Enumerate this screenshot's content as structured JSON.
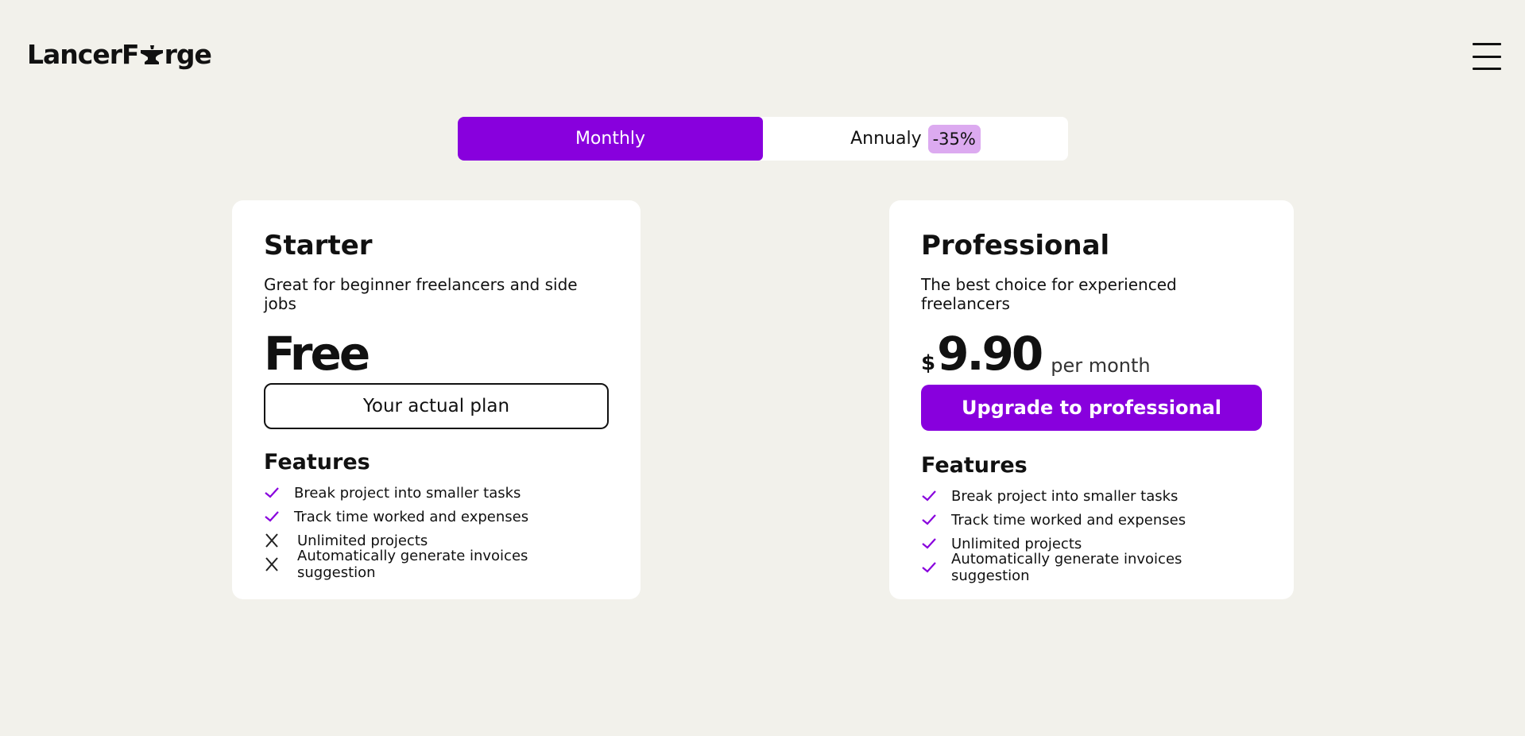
{
  "header": {
    "logo_left": "LancerF",
    "logo_right": "rge",
    "logo_icon": "anvil-icon",
    "menu_icon": "hamburger-menu-icon"
  },
  "billing_toggle": {
    "monthly_label": "Monthly",
    "annual_label": "Annualy",
    "annual_discount": "-35%",
    "selected": "Monthly"
  },
  "plans": [
    {
      "name": "Starter",
      "description": "Great for beginner freelancers and side jobs",
      "price": "Free",
      "button_label": "Your actual plan",
      "features_title": "Features",
      "features": [
        {
          "label": "Break project into smaller tasks",
          "included": true
        },
        {
          "label": "Track time worked and expenses",
          "included": true
        },
        {
          "label": "Unlimited projects",
          "included": false
        },
        {
          "label": "Automatically generate invoices suggestion",
          "included": false
        }
      ]
    },
    {
      "name": "Professional",
      "description": "The best choice for experienced freelancers",
      "currency": "$",
      "price": "9.90",
      "period": "per month",
      "button_label": "Upgrade to professional",
      "features_title": "Features",
      "features": [
        {
          "label": "Break project into smaller tasks",
          "included": true
        },
        {
          "label": "Track time worked and expenses",
          "included": true
        },
        {
          "label": "Unlimited projects",
          "included": true
        },
        {
          "label": "Automatically generate invoices suggestion",
          "included": true
        }
      ]
    }
  ],
  "colors": {
    "accent": "#8800dd",
    "discount_bg": "#dcaaf0",
    "background": "#f2f1eb",
    "card": "#ffffff"
  }
}
